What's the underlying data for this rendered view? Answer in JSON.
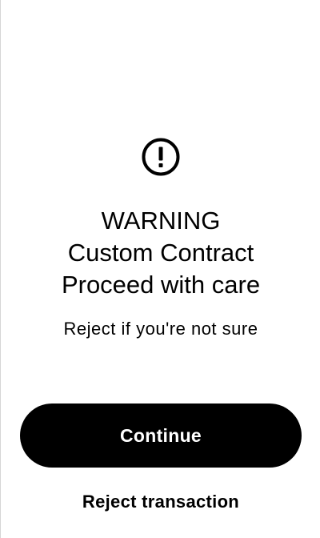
{
  "icon": {
    "name": "exclamation-circle-icon"
  },
  "title": {
    "line1": "WARNING",
    "line2": "Custom Contract",
    "line3": "Proceed with care"
  },
  "subtitle": "Reject if you're not sure",
  "actions": {
    "continue_label": "Continue",
    "reject_label": "Reject transaction"
  },
  "colors": {
    "background": "#ffffff",
    "text": "#000000",
    "primary_button_bg": "#000000",
    "primary_button_text": "#ffffff"
  }
}
